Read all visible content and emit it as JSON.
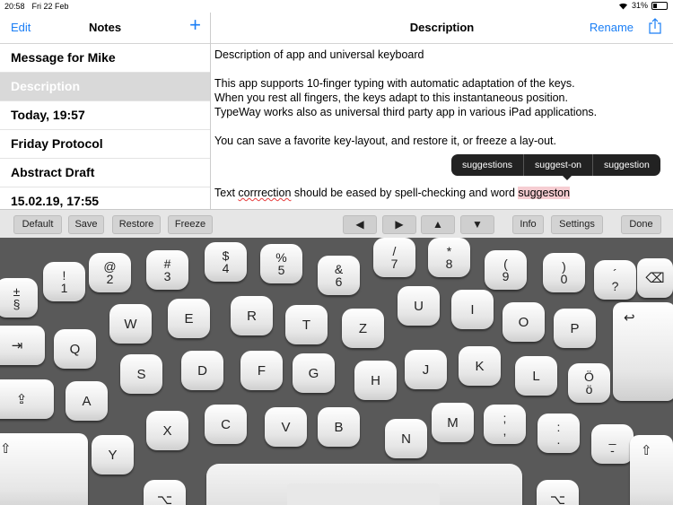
{
  "status": {
    "time": "20:58",
    "date": "Fri 22 Feb",
    "battery": "31%"
  },
  "notes_pane": {
    "edit_label": "Edit",
    "title": "Notes",
    "add_label": "+",
    "items": [
      "Message for Mike",
      "Description",
      "Today, 19:57",
      "Friday Protocol",
      "Abstract Draft",
      "15.02.19, 17:55"
    ],
    "selected_index": 1
  },
  "editor": {
    "title": "Description",
    "rename_label": "Rename",
    "line1": "Description of app and universal keyboard",
    "line2": "This app supports 10-finger typing with automatic adaptation of the keys.",
    "line3": "When you rest all fingers, the keys adapt to this instantaneous position.",
    "line4": "TypeWay works also as universal third party app in various iPad applications.",
    "line5": "You can save a favorite key-layout, and restore it, or freeze a lay-out.",
    "line6_a": "Text ",
    "line6_typo": "corrrection",
    "line6_b": " should be eased by spell-checking and word ",
    "line6_hl": "suggeston"
  },
  "suggestions": [
    "suggestions",
    "suggest-on",
    "suggestion"
  ],
  "toolbar": {
    "default": "Default",
    "save": "Save",
    "restore": "Restore",
    "freeze": "Freeze",
    "left": "◀",
    "right": "▶",
    "up": "▲",
    "down": "▼",
    "info": "Info",
    "settings": "Settings",
    "done": "Done"
  },
  "keyboard": {
    "keys": [
      {
        "top": "±",
        "bottom": "§"
      },
      {
        "top": "!",
        "bottom": "1"
      },
      {
        "top": "@",
        "bottom": "2"
      },
      {
        "top": "#",
        "bottom": "3"
      },
      {
        "top": "$",
        "bottom": "4"
      },
      {
        "top": "%",
        "bottom": "5"
      },
      {
        "top": "&",
        "bottom": "6"
      },
      {
        "top": "/",
        "bottom": "7"
      },
      {
        "top": "*",
        "bottom": "8"
      },
      {
        "top": "(",
        "bottom": "9"
      },
      {
        "top": ")",
        "bottom": "0"
      },
      {
        "top": "´",
        "bottom": "?"
      },
      {
        "label": "⌫"
      },
      {
        "label": "⇥"
      },
      {
        "label": "Q"
      },
      {
        "label": "W"
      },
      {
        "label": "E"
      },
      {
        "label": "R"
      },
      {
        "label": "T"
      },
      {
        "label": "Z"
      },
      {
        "label": "U"
      },
      {
        "label": "I"
      },
      {
        "label": "O"
      },
      {
        "label": "P"
      },
      {
        "label": "↩"
      },
      {
        "label": "⇪"
      },
      {
        "label": "A"
      },
      {
        "label": "S"
      },
      {
        "label": "D"
      },
      {
        "label": "F"
      },
      {
        "label": "G"
      },
      {
        "label": "H"
      },
      {
        "label": "J"
      },
      {
        "label": "K"
      },
      {
        "label": "L"
      },
      {
        "top": "Ö",
        "bottom": "ö"
      },
      {
        "label": "⇧"
      },
      {
        "label": "Y"
      },
      {
        "label": "X"
      },
      {
        "label": "C"
      },
      {
        "label": "V"
      },
      {
        "label": "B"
      },
      {
        "label": "N"
      },
      {
        "label": "M"
      },
      {
        "top": ";",
        "bottom": ","
      },
      {
        "top": ":",
        "bottom": "."
      },
      {
        "top": "_",
        "bottom": "-"
      },
      {
        "label": "⇧"
      },
      {
        "label": "⌥"
      },
      {
        "label": "⌥"
      }
    ]
  }
}
